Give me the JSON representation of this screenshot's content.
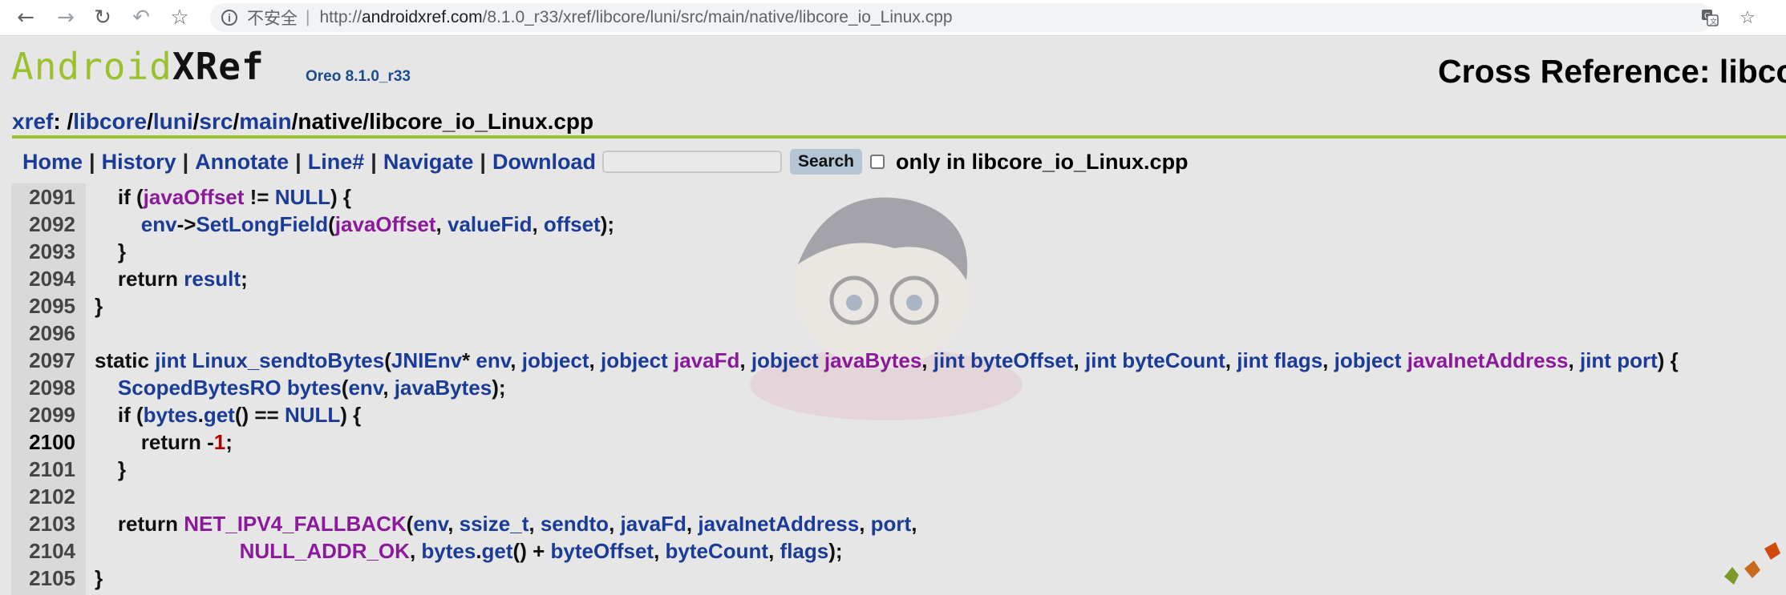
{
  "browser": {
    "back_icon": "arrow-left-icon",
    "forward_icon": "arrow-right-icon",
    "reload_icon": "reload-icon",
    "undo_icon": "undo-icon",
    "bookmark_icon": "star-icon",
    "security_label": "不安全",
    "separator": "|",
    "url_scheme": "http://",
    "url_host": "androidxref.com",
    "url_path": "/8.1.0_r33/xref/libcore/luni/src/main/native/libcore_io_Linux.cpp",
    "translate_icon": "translate-icon",
    "star_icon": "star-icon"
  },
  "header": {
    "logo_android": "Android",
    "logo_xref": "XRef",
    "version": "Oreo 8.1.0_r33",
    "title": "Cross Reference: libcor"
  },
  "breadcrumb": {
    "root": "xref",
    "colon": ": /",
    "parts": [
      "libcore",
      "luni",
      "src",
      "main"
    ],
    "tail": "/native/libcore_io_Linux.cpp"
  },
  "toolbar": {
    "home": "Home",
    "history": "History",
    "annotate": "Annotate",
    "line": "Line#",
    "navigate": "Navigate",
    "download": "Download",
    "search_button": "Search",
    "only_in_label": "only in libcore_io_Linux.cpp",
    "pipe": "|"
  },
  "code": {
    "current_line": 2100,
    "lines": [
      {
        "n": "2091",
        "tokens": [
          [
            "p",
            "    if ("
          ],
          [
            "m",
            "javaOffset"
          ],
          [
            "p",
            " != "
          ],
          [
            "u",
            "NULL"
          ],
          [
            "p",
            ") {"
          ]
        ]
      },
      {
        "n": "2092",
        "tokens": [
          [
            "p",
            "        "
          ],
          [
            "i",
            "env"
          ],
          [
            "p",
            "->"
          ],
          [
            "i",
            "SetLongField"
          ],
          [
            "p",
            "("
          ],
          [
            "m",
            "javaOffset"
          ],
          [
            "p",
            ", "
          ],
          [
            "i",
            "valueFid"
          ],
          [
            "p",
            ", "
          ],
          [
            "i",
            "offset"
          ],
          [
            "p",
            ");"
          ]
        ]
      },
      {
        "n": "2093",
        "tokens": [
          [
            "p",
            "    }"
          ]
        ]
      },
      {
        "n": "2094",
        "tokens": [
          [
            "p",
            "    return "
          ],
          [
            "i",
            "result"
          ],
          [
            "p",
            ";"
          ]
        ]
      },
      {
        "n": "2095",
        "tokens": [
          [
            "p",
            "}"
          ]
        ]
      },
      {
        "n": "2096",
        "tokens": []
      },
      {
        "n": "2097",
        "tokens": [
          [
            "p",
            "static "
          ],
          [
            "i",
            "jint"
          ],
          [
            "p",
            " "
          ],
          [
            "i",
            "Linux_sendtoBytes"
          ],
          [
            "p",
            "("
          ],
          [
            "i",
            "JNIEnv"
          ],
          [
            "p",
            "* "
          ],
          [
            "i",
            "env"
          ],
          [
            "p",
            ", "
          ],
          [
            "i",
            "jobject"
          ],
          [
            "p",
            ", "
          ],
          [
            "i",
            "jobject"
          ],
          [
            "p",
            " "
          ],
          [
            "m",
            "javaFd"
          ],
          [
            "p",
            ", "
          ],
          [
            "i",
            "jobject"
          ],
          [
            "p",
            " "
          ],
          [
            "m",
            "javaBytes"
          ],
          [
            "p",
            ", "
          ],
          [
            "i",
            "jint"
          ],
          [
            "p",
            " "
          ],
          [
            "i",
            "byteOffset"
          ],
          [
            "p",
            ", "
          ],
          [
            "i",
            "jint"
          ],
          [
            "p",
            " "
          ],
          [
            "i",
            "byteCount"
          ],
          [
            "p",
            ", "
          ],
          [
            "i",
            "jint"
          ],
          [
            "p",
            " "
          ],
          [
            "i",
            "flags"
          ],
          [
            "p",
            ", "
          ],
          [
            "i",
            "jobject"
          ],
          [
            "p",
            " "
          ],
          [
            "m",
            "javaInetAddress"
          ],
          [
            "p",
            ", "
          ],
          [
            "i",
            "jint"
          ],
          [
            "p",
            " "
          ],
          [
            "i",
            "port"
          ],
          [
            "p",
            ") {"
          ]
        ]
      },
      {
        "n": "2098",
        "tokens": [
          [
            "p",
            "    "
          ],
          [
            "i",
            "ScopedBytesRO"
          ],
          [
            "p",
            " "
          ],
          [
            "i",
            "bytes"
          ],
          [
            "p",
            "("
          ],
          [
            "i",
            "env"
          ],
          [
            "p",
            ", "
          ],
          [
            "i",
            "javaBytes"
          ],
          [
            "p",
            ");"
          ]
        ]
      },
      {
        "n": "2099",
        "tokens": [
          [
            "p",
            "    if ("
          ],
          [
            "i",
            "bytes"
          ],
          [
            "p",
            "."
          ],
          [
            "i",
            "get"
          ],
          [
            "p",
            "() == "
          ],
          [
            "u",
            "NULL"
          ],
          [
            "p",
            ") {"
          ]
        ]
      },
      {
        "n": "2100",
        "tokens": [
          [
            "p",
            "        return -"
          ],
          [
            "n",
            "1"
          ],
          [
            "p",
            ";"
          ]
        ]
      },
      {
        "n": "2101",
        "tokens": [
          [
            "p",
            "    }"
          ]
        ]
      },
      {
        "n": "2102",
        "tokens": []
      },
      {
        "n": "2103",
        "tokens": [
          [
            "p",
            "    return "
          ],
          [
            "m",
            "NET_IPV4_FALLBACK"
          ],
          [
            "p",
            "("
          ],
          [
            "i",
            "env"
          ],
          [
            "p",
            ", "
          ],
          [
            "i",
            "ssize_t"
          ],
          [
            "p",
            ", "
          ],
          [
            "i",
            "sendto"
          ],
          [
            "p",
            ", "
          ],
          [
            "i",
            "javaFd"
          ],
          [
            "p",
            ", "
          ],
          [
            "i",
            "javaInetAddress"
          ],
          [
            "p",
            ", "
          ],
          [
            "i",
            "port"
          ],
          [
            "p",
            ","
          ]
        ]
      },
      {
        "n": "2104",
        "tokens": [
          [
            "p",
            "                         "
          ],
          [
            "m",
            "NULL_ADDR_OK"
          ],
          [
            "p",
            ", "
          ],
          [
            "i",
            "bytes"
          ],
          [
            "p",
            "."
          ],
          [
            "i",
            "get"
          ],
          [
            "p",
            "() + "
          ],
          [
            "i",
            "byteOffset"
          ],
          [
            "p",
            ", "
          ],
          [
            "i",
            "byteCount"
          ],
          [
            "p",
            ", "
          ],
          [
            "i",
            "flags"
          ],
          [
            "p",
            ");"
          ]
        ]
      },
      {
        "n": "2105",
        "tokens": [
          [
            "p",
            "}"
          ]
        ]
      }
    ]
  }
}
